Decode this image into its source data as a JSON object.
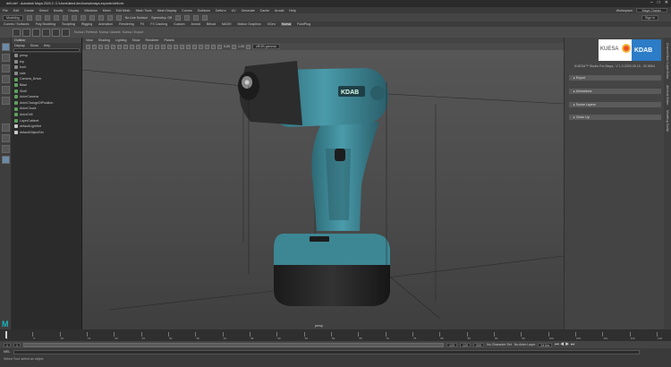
{
  "window": {
    "title": "drill.mb* - Autodesk Maya 2020.2: C:\\Users\\kimd.dev\\kuesa\\maya-exporter\\drill.mb",
    "controls": [
      "–",
      "□",
      "✕"
    ]
  },
  "menubar": {
    "items": [
      "File",
      "Edit",
      "Create",
      "Select",
      "Modify",
      "Display",
      "Windows",
      "Mesh",
      "Edit Mesh",
      "Mesh Tools",
      "Mesh Display",
      "Curves",
      "Surfaces",
      "Deform",
      "UV",
      "Generate",
      "Cache",
      "Arnold",
      "Help"
    ],
    "workspace_label": "Workspace:",
    "workspace_value": "Maya Classic"
  },
  "statusline": {
    "menuset": "Modeling",
    "live_surface": "No Live Surface",
    "symmetry": "Symmetry: Off",
    "signin": "Sign in"
  },
  "shelf": {
    "tabs": [
      "Curves / Surfaces",
      "Poly Modeling",
      "Sculpting",
      "Rigging",
      "Animation",
      "Rendering",
      "FX",
      "FX Caching",
      "Custom",
      "Arnold",
      "Bifrost",
      "MASH",
      "Motion Graphics",
      "XGen",
      "Kuesa",
      "FluidPlug"
    ],
    "selected_tab": "Kuesa",
    "shelf_label_1": "Kuesa / Refresh",
    "shelf_label_2": "Kuesa / Assets",
    "shelf_label_3": "Kuesa / Export"
  },
  "outliner": {
    "title": "Outliner",
    "menus": [
      "Display",
      "Show",
      "Help"
    ],
    "items": [
      {
        "label": "persp",
        "icon": "camera-icon",
        "color": "#8a8a8a"
      },
      {
        "label": "top",
        "icon": "camera-icon",
        "color": "#8a8a8a"
      },
      {
        "label": "front",
        "icon": "camera-icon",
        "color": "#8a8a8a"
      },
      {
        "label": "side",
        "icon": "camera-icon",
        "color": "#8a8a8a"
      },
      {
        "label": "Camera_Driver",
        "icon": "transform-icon",
        "color": "#5fa05f"
      },
      {
        "label": "Base",
        "icon": "transform-icon",
        "color": "#5fa05f"
      },
      {
        "label": "Shell",
        "icon": "transform-icon",
        "color": "#5fa05f"
      },
      {
        "label": "AnimCamera",
        "icon": "transform-icon",
        "color": "#5fa05f"
      },
      {
        "label": "AnimChangeOfPosition",
        "icon": "transform-icon",
        "color": "#5fa05f"
      },
      {
        "label": "AnimChuck",
        "icon": "transform-icon",
        "color": "#5fa05f"
      },
      {
        "label": "AnimDrill",
        "icon": "transform-icon",
        "color": "#5fa05f"
      },
      {
        "label": "LayerCabinet",
        "icon": "transform-icon",
        "color": "#5fa05f"
      },
      {
        "label": "defaultLightSet",
        "icon": "set-icon",
        "color": "#c9c9c9"
      },
      {
        "label": "defaultObjectSet",
        "icon": "set-icon",
        "color": "#c9c9c9"
      }
    ]
  },
  "viewport": {
    "menus": [
      "View",
      "Shading",
      "Lighting",
      "Show",
      "Renderer",
      "Panels"
    ],
    "exposure": "0.00",
    "gamma": "1.00",
    "color_space": "sRGB gamma",
    "camera_label": "persp",
    "product": {
      "brand": "KDAB",
      "body": "#3f8a98",
      "battery": "#2a2a2a"
    }
  },
  "right_panel": {
    "logo_left": "KUESA",
    "logo_right": "KDAB",
    "version_text": "KUESA™ Studio For Maya - V 1.3.2020.05.15 - 02.8504",
    "sections": [
      "Export",
      "Animations",
      "Scene Layers",
      "Clean Up"
    ],
    "side_tabs": [
      "Channel Box / Layer Editor",
      "Attribute Editor",
      "Modeling Toolkit"
    ]
  },
  "timeslider": {
    "ticks": [
      "1",
      "5",
      "10",
      "15",
      "20",
      "25",
      "30",
      "35",
      "40",
      "45",
      "50",
      "55",
      "60",
      "65",
      "70",
      "75",
      "80",
      "85",
      "90",
      "95",
      "100",
      "105",
      "110",
      "115",
      "120"
    ],
    "current_frame": "1"
  },
  "rangebar": {
    "start": "1",
    "inner_start": "1",
    "inner_end": "120",
    "end": "120",
    "end2": "200",
    "character_set": "No Character Set",
    "anim_layer": "No Anim Layer",
    "fps": "24 fps"
  },
  "cmdline": {
    "lang": "MEL",
    "help": "Select Tool: select an object"
  }
}
